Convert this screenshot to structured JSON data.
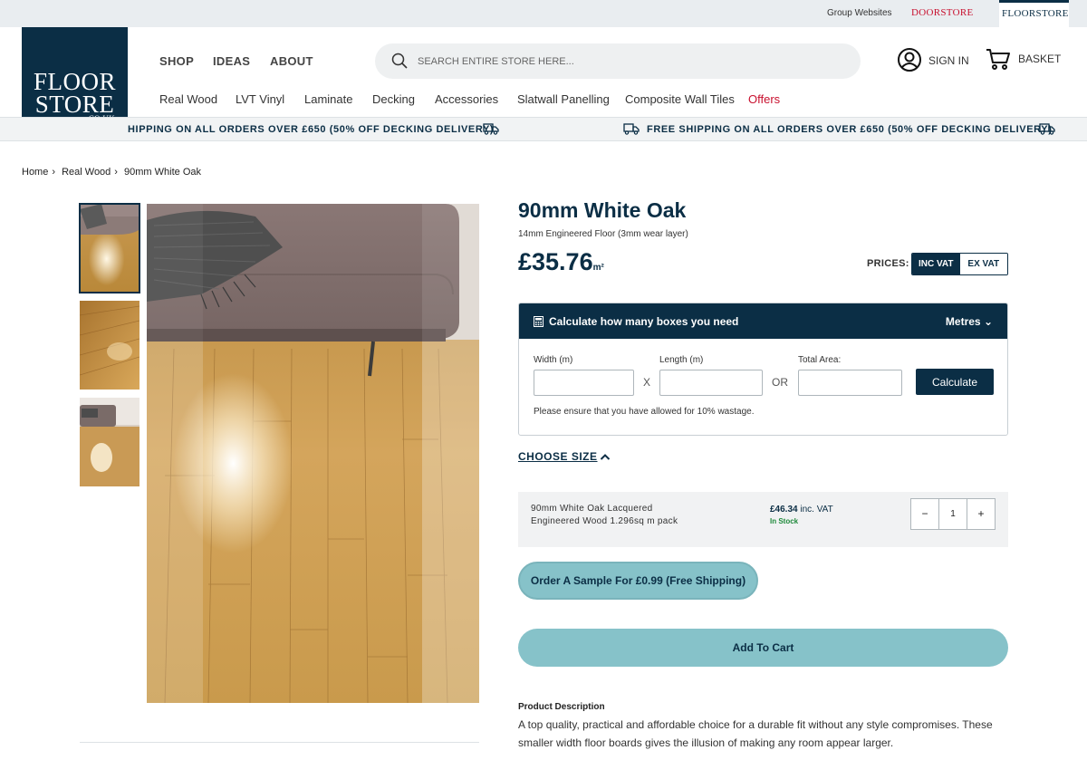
{
  "topbar": {
    "group_websites": "Group Websites",
    "doorstore": "DOORSTORE",
    "floorstore": "FLOORSTORE"
  },
  "logo": {
    "line1": "FLOOR",
    "line2": "STORE",
    "suffix": ".CO.UK"
  },
  "main_nav": [
    "SHOP",
    "IDEAS",
    "ABOUT"
  ],
  "search": {
    "placeholder": "SEARCH ENTIRE STORE HERE..."
  },
  "account": {
    "sign_in": "SIGN IN",
    "basket": "BASKET"
  },
  "categories": [
    "Real Wood",
    "LVT Vinyl",
    "Laminate",
    "Decking",
    "Accessories",
    "Slatwall Panelling",
    "Composite Wall Tiles",
    "Offers"
  ],
  "shipping_banner": {
    "text_left": "HIPPING ON ALL ORDERS OVER £650 (50% OFF DECKING DELIVERY)",
    "text_right": "FREE SHIPPING ON ALL ORDERS OVER £650 (50% OFF DECKING DELIVERY)"
  },
  "breadcrumb": [
    "Home",
    "Real Wood",
    "90mm White Oak"
  ],
  "product": {
    "title": "90mm White Oak",
    "subtitle": "14mm Engineered Floor (3mm wear layer)",
    "price": "£35.76",
    "price_unit": "m²",
    "prices_label": "PRICES:",
    "inc_vat": "INC VAT",
    "ex_vat": "EX VAT"
  },
  "calculator": {
    "heading": "Calculate how many boxes you need",
    "units": "Metres",
    "width_label": "Width (m)",
    "length_label": "Length (m)",
    "total_label": "Total Area:",
    "x_sep": "X",
    "or_sep": "OR",
    "button": "Calculate",
    "note": "Please ensure that you have allowed for 10% wastage."
  },
  "sizes": {
    "heading": "CHOOSE SIZE",
    "item": {
      "name_line1": "90mm White Oak Lacquered",
      "name_line2": "Engineered Wood 1.296sq m pack",
      "price": "£46.34",
      "price_suffix": "inc. VAT",
      "stock": "In Stock",
      "qty_minus": "−",
      "qty_value": "1",
      "qty_plus": "+"
    }
  },
  "buttons": {
    "sample": "Order A Sample For £0.99 (Free Shipping)",
    "add_to_cart": "Add To Cart"
  },
  "description": {
    "heading": "Product Description",
    "text": "A top quality, practical and affordable choice for a durable fit without any style compromises. These smaller width floor boards gives the illusion of making any room appear larger."
  },
  "colors": {
    "brand_navy": "#0b2e45",
    "accent_teal": "#86c2c9",
    "offer_red": "#c8102e",
    "stock_green": "#1f8a3b"
  }
}
